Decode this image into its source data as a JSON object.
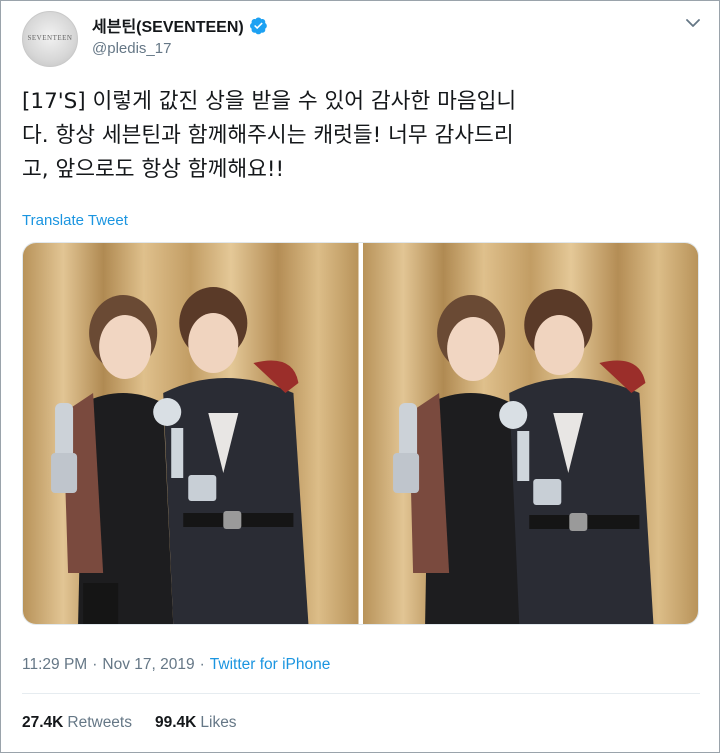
{
  "tweet": {
    "author": {
      "display_name": "세븐틴(SEVENTEEN)",
      "handle": "@pledis_17",
      "avatar_text": "SEVENTEEN",
      "verified": true
    },
    "text": "[17'S] 이렇게 값진 상을 받을 수 있어 감사한 마음입니\n다. 항상 세븐틴과 함께해주시는 캐럿들! 너무 감사드리\n고, 앞으로도 항상 함께해요!!",
    "translate_label": "Translate Tweet",
    "time": "11:29 PM",
    "date": "Nov 17, 2019",
    "separator": "·",
    "source": "Twitter for iPhone",
    "retweets_count": "27.4K",
    "retweets_label": "Retweets",
    "likes_count": "99.4K",
    "likes_label": "Likes"
  },
  "icons": {
    "verified": "verified-badge-icon",
    "caret": "chevron-down-icon"
  },
  "colors": {
    "link": "#1b95e0",
    "secondary_text": "#657786",
    "primary_text": "#14171a",
    "curtain": "#c9a46a"
  }
}
